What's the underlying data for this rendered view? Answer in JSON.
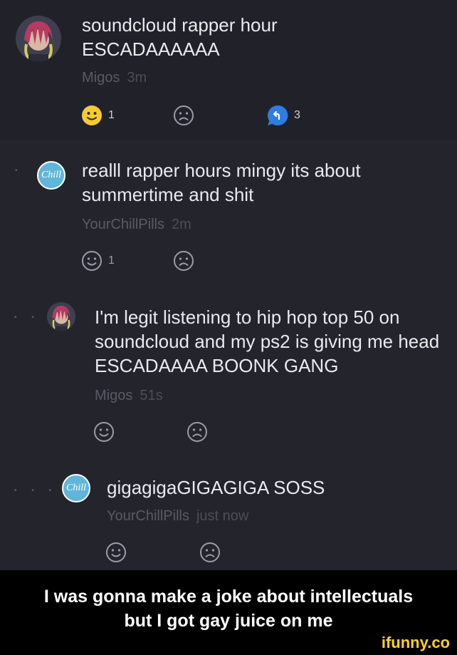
{
  "colors": {
    "background": "#24252c",
    "meta_text": "#585a65",
    "reply_blue": "#2f7de1",
    "smile_yellow": "#f3cb34",
    "chill_avatar": "#5fb6d8"
  },
  "comments": [
    {
      "text": "soundcloud rapper hour ESCADAAAAAA",
      "author": "Migos",
      "time": "3m",
      "smile_count": "1",
      "reply_count": "3",
      "avatar_icon": "rapper-portrait-avatar"
    },
    {
      "text": "realll rapper hours mingy its about summertime and shit",
      "author": "YourChillPills",
      "time": "2m",
      "smile_count": "1",
      "avatar_text": "Chill",
      "indent_dots": "•"
    },
    {
      "text": "I'm legit listening to hip hop top 50 on soundcloud and my ps2 is giving me head ESCADAAAA BOONK GANG",
      "author": "Migos",
      "time": "51s",
      "avatar_icon": "rapper-portrait-avatar",
      "indent_dots": "• •"
    },
    {
      "text": "gigagigaGIGAGIGA SOSS",
      "author": "YourChillPills",
      "time": "just now",
      "avatar_text": "Chill",
      "indent_dots": "• • •"
    }
  ],
  "caption": {
    "line1": "I was gonna make a joke about intellectuals",
    "line2": "but I got gay juice on me"
  },
  "watermark": "ifunny.co"
}
